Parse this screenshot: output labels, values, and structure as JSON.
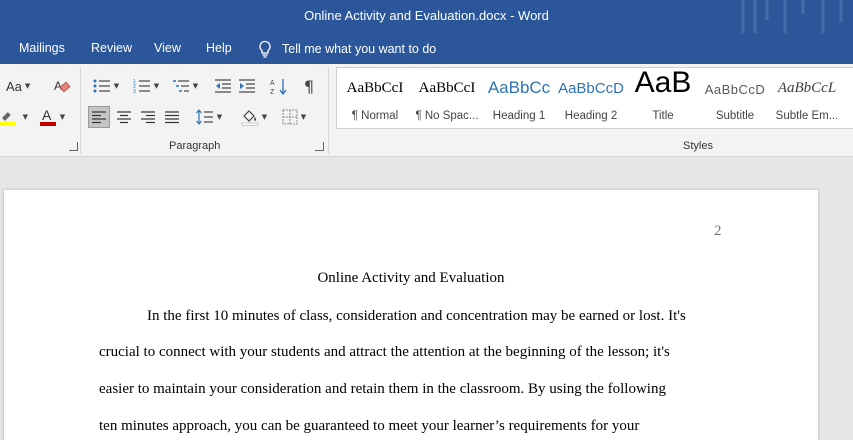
{
  "window": {
    "title": "Online Activity and Evaluation.docx  -  Word"
  },
  "tabs": [
    "Mailings",
    "Review",
    "View",
    "Help"
  ],
  "tell_me": "Tell me what you want to do",
  "ribbon": {
    "font_group": {
      "change_case_label": "Aa"
    },
    "paragraph": {
      "label": "Paragraph"
    },
    "styles": {
      "label": "Styles",
      "items": [
        {
          "preview": "AaBbCcI",
          "name": "¶ Normal"
        },
        {
          "preview": "AaBbCcI",
          "name": "¶ No Spac..."
        },
        {
          "preview": "AaBbCc",
          "name": "Heading 1"
        },
        {
          "preview": "AaBbCcD",
          "name": "Heading 2"
        },
        {
          "preview": "AaB",
          "name": "Title"
        },
        {
          "preview": "AaBbCcD",
          "name": "Subtitle"
        },
        {
          "preview": "AaBbCcL",
          "name": "Subtle Em..."
        }
      ]
    }
  },
  "document": {
    "page_number": "2",
    "title": "Online Activity and Evaluation",
    "lines": [
      "In the first 10 minutes of class, consideration and concentration may be earned or lost. It's",
      "crucial to connect with your students and attract the attention at the beginning of the lesson; it's",
      "easier to maintain your consideration and retain them in the classroom. By using the following",
      "ten minutes approach, you can be guaranteed to meet your learner’s requirements for your"
    ]
  },
  "colors": {
    "title_bar": "#2b579a",
    "ribbon_bg": "#f3f3f3",
    "heading_blue": "#2e74b5",
    "font_color_red": "#c00000",
    "highlight_yellow": "#ffff00"
  }
}
